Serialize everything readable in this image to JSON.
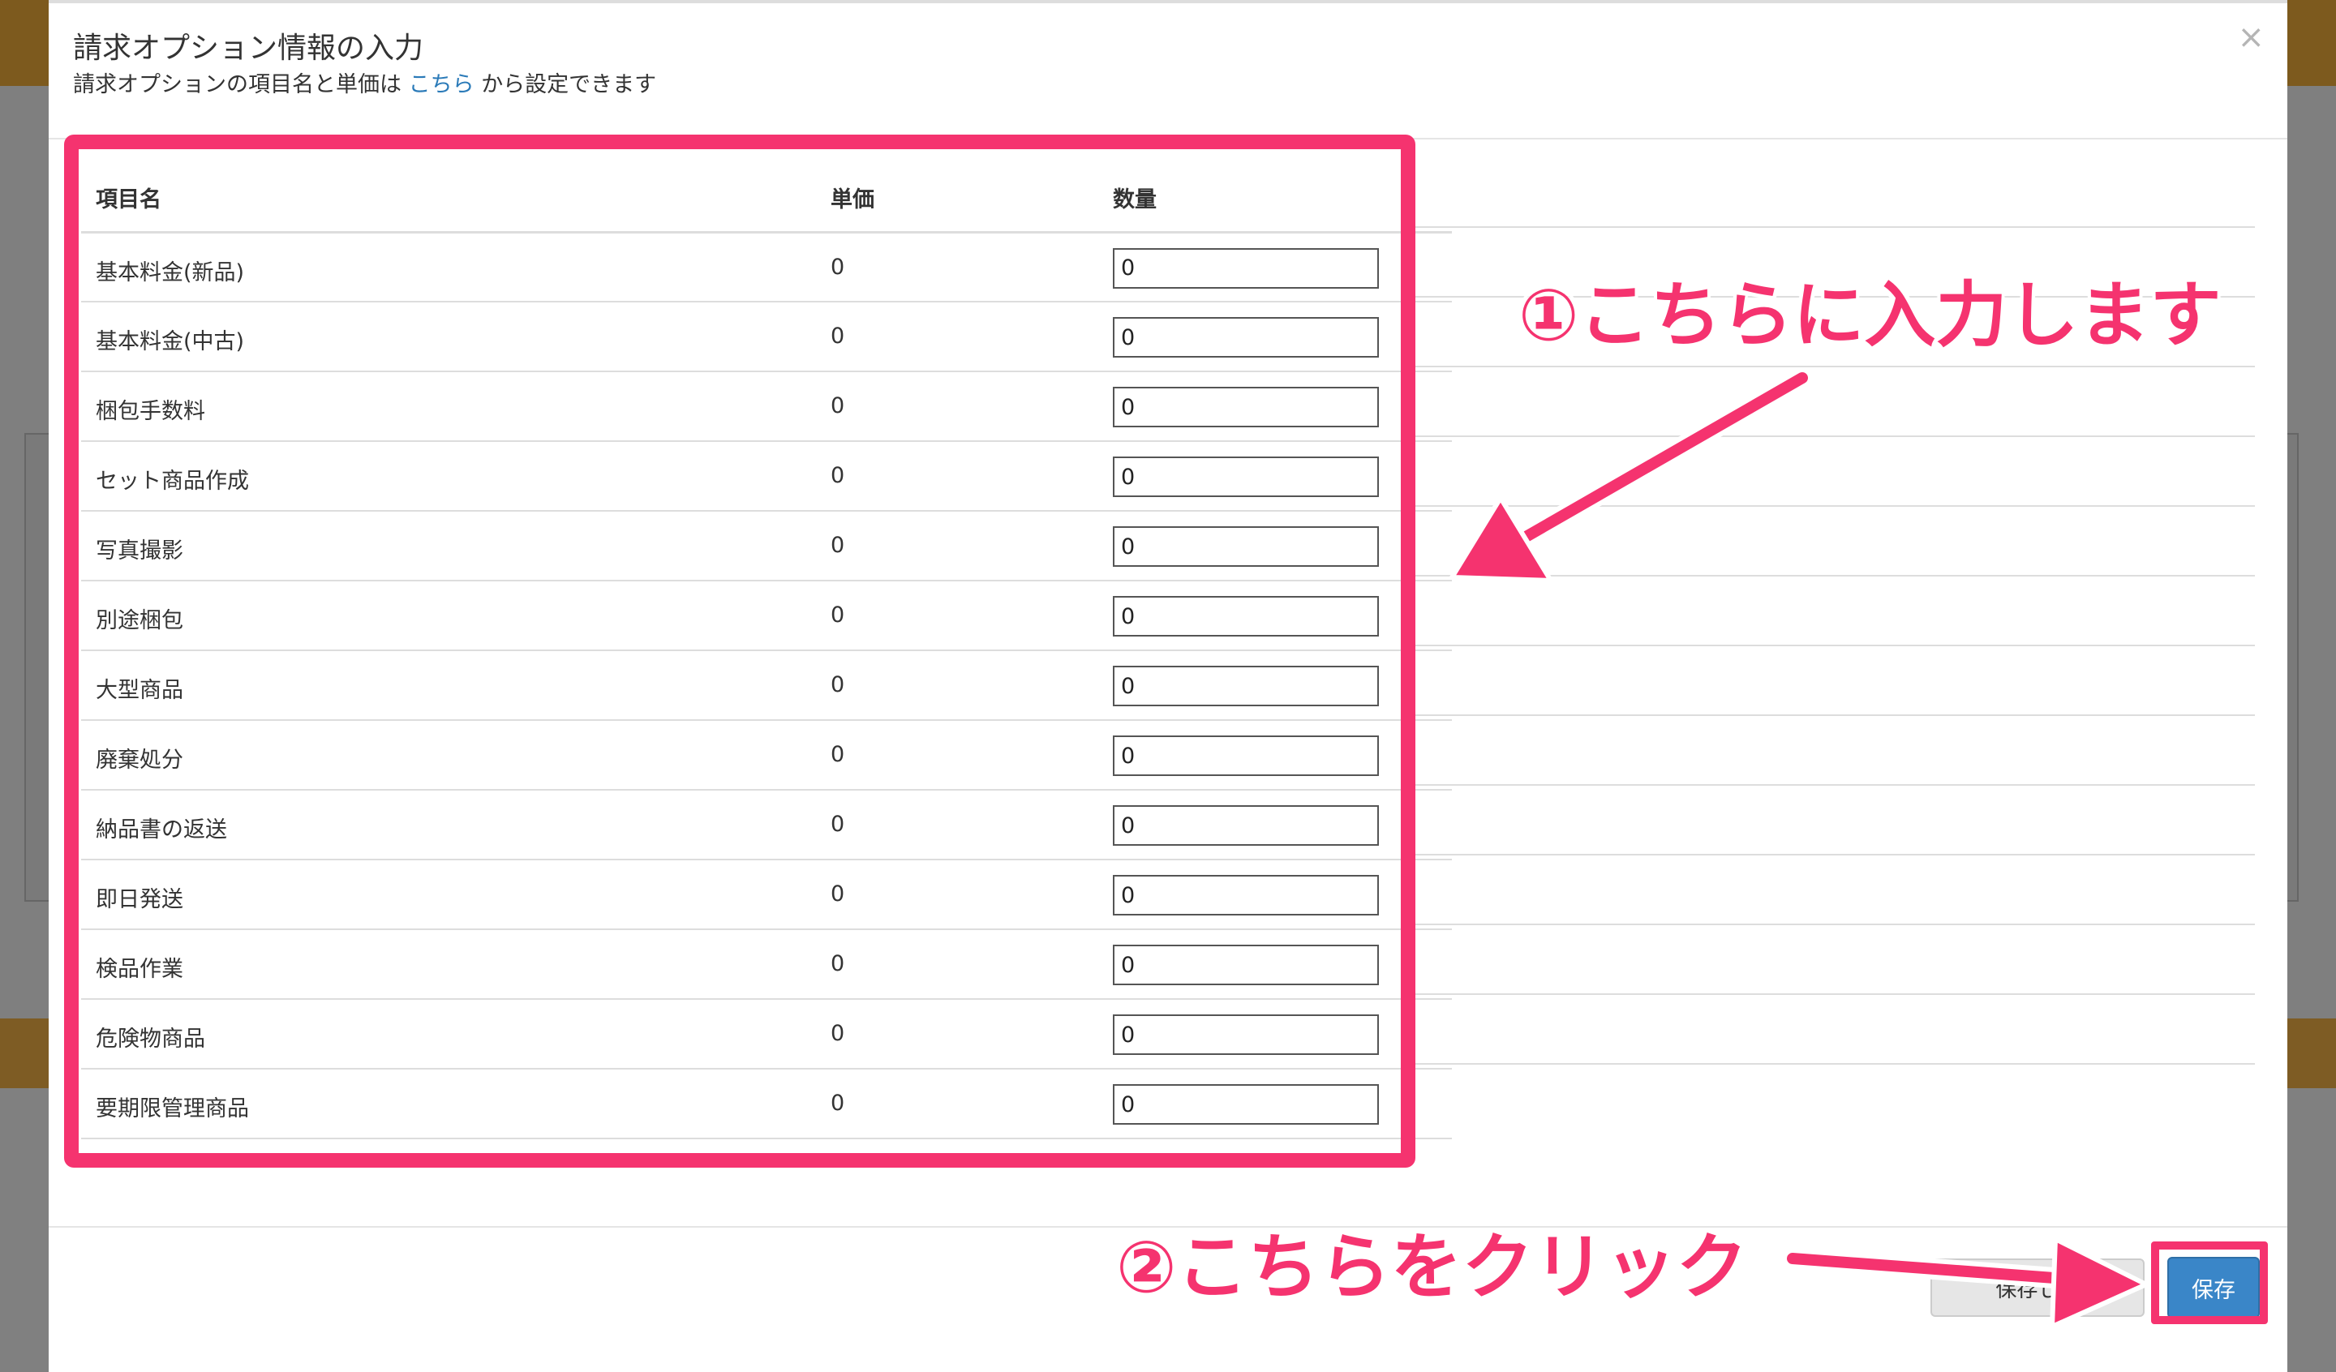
{
  "modal": {
    "title": "請求オプション情報の入力",
    "subtitle_pre": "請求オプションの項目名と単価は",
    "subtitle_link": "こちら",
    "subtitle_post": "から設定できます",
    "close": "×"
  },
  "table": {
    "headers": [
      "項目名",
      "単価",
      "数量"
    ],
    "rows": [
      {
        "name": "基本料金(新品)",
        "price": "0",
        "qty": "0"
      },
      {
        "name": "基本料金(中古)",
        "price": "0",
        "qty": "0"
      },
      {
        "name": "梱包手数料",
        "price": "0",
        "qty": "0"
      },
      {
        "name": "セット商品作成",
        "price": "0",
        "qty": "0"
      },
      {
        "name": "写真撮影",
        "price": "0",
        "qty": "0"
      },
      {
        "name": "別途梱包",
        "price": "0",
        "qty": "0"
      },
      {
        "name": "大型商品",
        "price": "0",
        "qty": "0"
      },
      {
        "name": "廃棄処分",
        "price": "0",
        "qty": "0"
      },
      {
        "name": "納品書の返送",
        "price": "0",
        "qty": "0"
      },
      {
        "name": "即日発送",
        "price": "0",
        "qty": "0"
      },
      {
        "name": "検品作業",
        "price": "0",
        "qty": "0"
      },
      {
        "name": "危険物商品",
        "price": "0",
        "qty": "0"
      },
      {
        "name": "要期限管理商品",
        "price": "0",
        "qty": "0"
      }
    ]
  },
  "footer": {
    "secondary_label": "保存して",
    "save_label": "保存"
  },
  "annotations": {
    "step1": "①こちらに入力します",
    "step2": "②こちらをクリック"
  },
  "colors": {
    "highlight": "#f5336f",
    "save_button": "#3a86c8",
    "link": "#2a7ab8"
  }
}
